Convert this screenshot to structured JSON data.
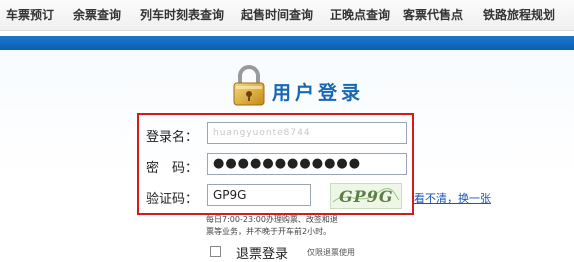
{
  "nav": {
    "items": [
      {
        "label": "车票预订"
      },
      {
        "label": "余票查询"
      },
      {
        "label": "列车时刻表查询"
      },
      {
        "label": "起售时间查询"
      },
      {
        "label": "正晚点查询"
      },
      {
        "label": "客票代售点"
      },
      {
        "label": "铁路旅程规划"
      }
    ]
  },
  "login": {
    "title": "用户登录",
    "username_label": "登录名：",
    "username_value": "huangyuonte8744",
    "password_label": "密　码：",
    "password_value": "●●●●●●●●●●●●",
    "captcha_label": "验证码：",
    "captcha_value": "GP9G",
    "captcha_image_text": "GP9G",
    "captcha_refresh": "看不清，换一张",
    "hint_line1": "每日7:00-23:00办理购票、改签和退",
    "hint_line2": "票等业务，并不晚于开车前2小时。",
    "refund_label": "退票登录",
    "refund_note": "仅限退票使用"
  },
  "colors": {
    "accent_blue": "#1767b5",
    "band_blue": "#0a5fb3",
    "highlight_red": "#d51a1a",
    "link_blue": "#1a56b4"
  },
  "icons": {
    "lock": "lock-icon",
    "captcha": "captcha-image"
  }
}
